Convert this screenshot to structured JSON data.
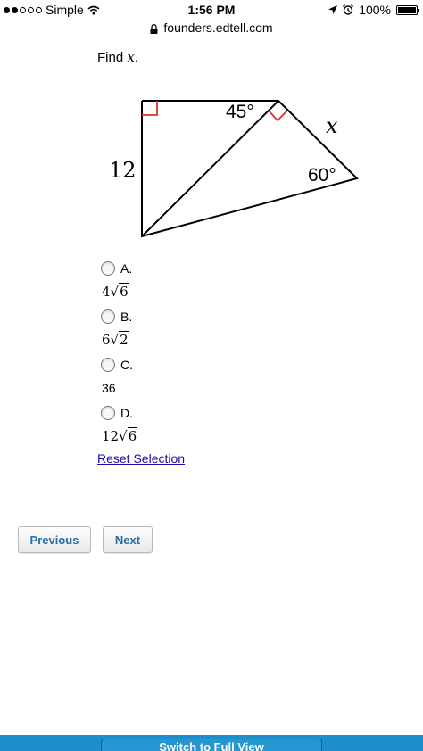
{
  "status_bar": {
    "carrier": "Simple",
    "time": "1:56 PM",
    "battery": "100%"
  },
  "url_bar": {
    "url": "founders.edtell.com"
  },
  "question": {
    "prompt_prefix": "Find ",
    "variable": "x",
    "prompt_suffix": "."
  },
  "figure": {
    "side_label": "12",
    "angle_top": "45°",
    "angle_right": "60°",
    "unknown": "x",
    "right_angle_color": "#e0302a"
  },
  "options": [
    {
      "letter": "A.",
      "coef": "4",
      "radicand": "6",
      "text": ""
    },
    {
      "letter": "B.",
      "coef": "6",
      "radicand": "2",
      "text": ""
    },
    {
      "letter": "C.",
      "coef": "",
      "radicand": "",
      "text": "36"
    },
    {
      "letter": "D.",
      "coef": "12",
      "radicand": "6",
      "text": ""
    }
  ],
  "reset_label": "Reset Selection",
  "nav": {
    "previous_label": "Previous",
    "next_label": "Next"
  },
  "footer": {
    "button_label": "Switch to Full View",
    "color": "#1d8ec9"
  }
}
